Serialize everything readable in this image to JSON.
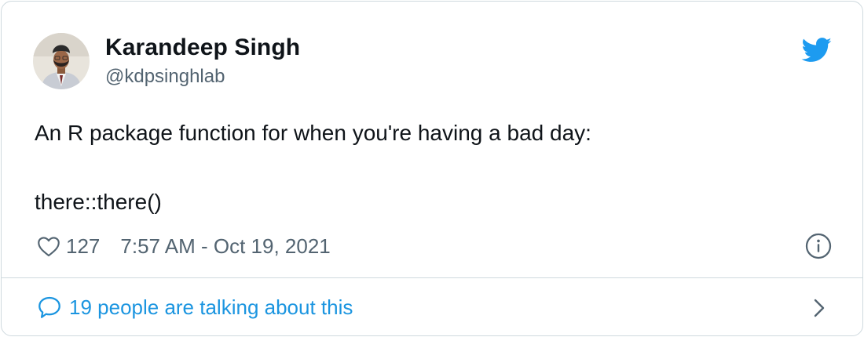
{
  "author": {
    "display_name": "Karandeep Singh",
    "handle": "@kdpsinghlab"
  },
  "tweet": {
    "line1": "An R package function for when you're having a bad day:",
    "line2": "there::there()"
  },
  "stats": {
    "like_count": "127",
    "timestamp": "7:57 AM - Oct 19, 2021"
  },
  "footer": {
    "talking_text": "19 people are talking about this"
  },
  "icons": {
    "brand": "twitter-bird-icon",
    "like": "heart-icon",
    "info": "info-icon",
    "conversation": "speech-bubble-icon",
    "chevron": "chevron-right-icon"
  },
  "colors": {
    "twitter_blue": "#1d9bf0",
    "link_blue": "#1b95e0",
    "text_primary": "#0f1419",
    "text_secondary": "#536471",
    "border": "#cfd9de"
  }
}
